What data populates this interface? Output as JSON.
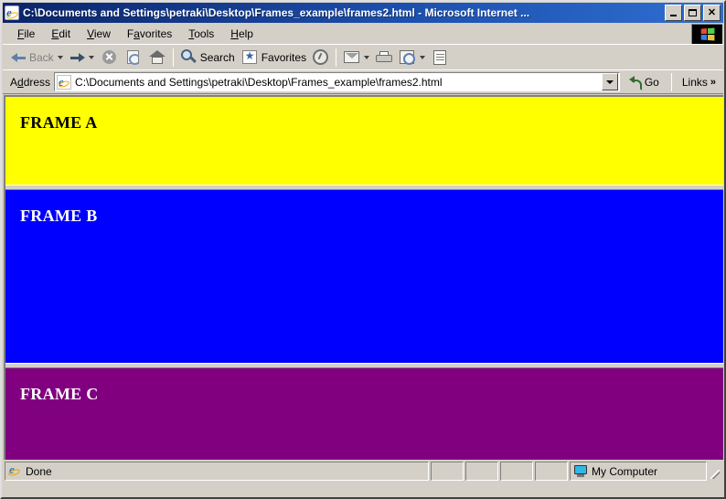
{
  "window": {
    "title": "C:\\Documents and Settings\\petraki\\Desktop\\Frames_example\\frames2.html - Microsoft Internet ...",
    "icon": "ie-document-icon",
    "controls": {
      "minimize": "Minimize",
      "maximize": "Maximize",
      "close": "Close",
      "close_glyph": "✕"
    }
  },
  "menu": {
    "items": [
      {
        "label": "File",
        "accel": "F",
        "pre": "",
        "post": "ile"
      },
      {
        "label": "Edit",
        "accel": "E",
        "pre": "",
        "post": "dit"
      },
      {
        "label": "View",
        "accel": "V",
        "pre": "",
        "post": "iew"
      },
      {
        "label": "Favorites",
        "accel": "a",
        "pre": "F",
        "post": "vorites"
      },
      {
        "label": "Tools",
        "accel": "T",
        "pre": "",
        "post": "ools"
      },
      {
        "label": "Help",
        "accel": "H",
        "pre": "",
        "post": "elp"
      }
    ],
    "logo": "windows-flag-logo"
  },
  "toolbar": {
    "back": "Back",
    "forward": "",
    "stop": "stop-icon",
    "refresh": "refresh-icon",
    "home": "home-icon",
    "search": "Search",
    "favorites": "Favorites",
    "media": "media-icon",
    "mail": "mail-icon",
    "print": "print-icon",
    "fullscreen": "fullscreen-icon",
    "discuss": "discuss-icon"
  },
  "address": {
    "label_pre": "A",
    "label_accel": "d",
    "label_post": "dress",
    "value": "C:\\Documents and Settings\\petraki\\Desktop\\Frames_example\\frames2.html",
    "placeholder": "",
    "go_label": "Go",
    "links_label": "Links",
    "links_chevron": "»"
  },
  "frames": [
    {
      "name": "frame-a",
      "label": "FRAME A",
      "bg": "#FFFF00",
      "fg": "#000000"
    },
    {
      "name": "frame-b",
      "label": "FRAME B",
      "bg": "#0000FF",
      "fg": "#FFFFFF"
    },
    {
      "name": "frame-c",
      "label": "FRAME C",
      "bg": "#800080",
      "fg": "#FFFFFF"
    }
  ],
  "status": {
    "message": "Done",
    "zone": "My Computer",
    "zone_icon": "my-computer-icon",
    "page_icon": "ie-icon"
  },
  "colors": {
    "titlebar_start": "#0a246a",
    "titlebar_end": "#2f6ed0",
    "chrome": "#d4d0c8",
    "frame_a": "#FFFF00",
    "frame_b": "#0000FF",
    "frame_c": "#800080"
  }
}
